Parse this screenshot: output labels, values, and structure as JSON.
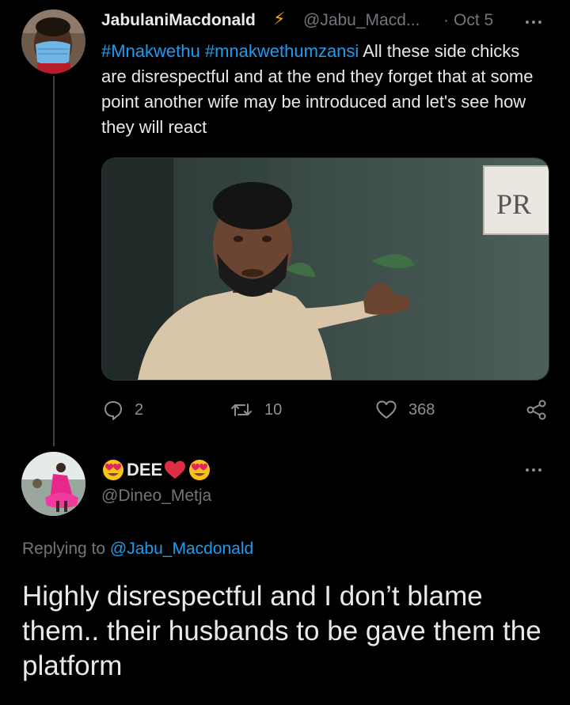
{
  "tweet": {
    "display_name": "JabulaniMacdonald",
    "name_emoji": "⚡",
    "handle": "@Jabu_Macd...",
    "separator": "·",
    "date": "Oct 5",
    "hashtag_1": "#Mnakwethu",
    "hashtag_2": "#mnakwethumzansi",
    "text": "All these side chicks are disrespectful and at the end they forget that at some point another wife may be introduced and let's see how they will react",
    "media_sign_text": "PR",
    "stats": {
      "replies": "2",
      "retweets": "10",
      "likes": "368"
    }
  },
  "reply": {
    "display_name": "DEE",
    "handle": "@Dineo_Metja",
    "replying_prefix": "Replying to",
    "replying_handle": "@Jabu_Macdonald",
    "text": "Highly disrespectful and I don’t blame them.. their husbands to be gave them the platform"
  },
  "colors": {
    "background": "#000000",
    "text": "#e7e9ea",
    "muted": "#71767b",
    "link": "#1d9bf0",
    "lightning": "#f7a21b",
    "heart": "#e0245e"
  }
}
